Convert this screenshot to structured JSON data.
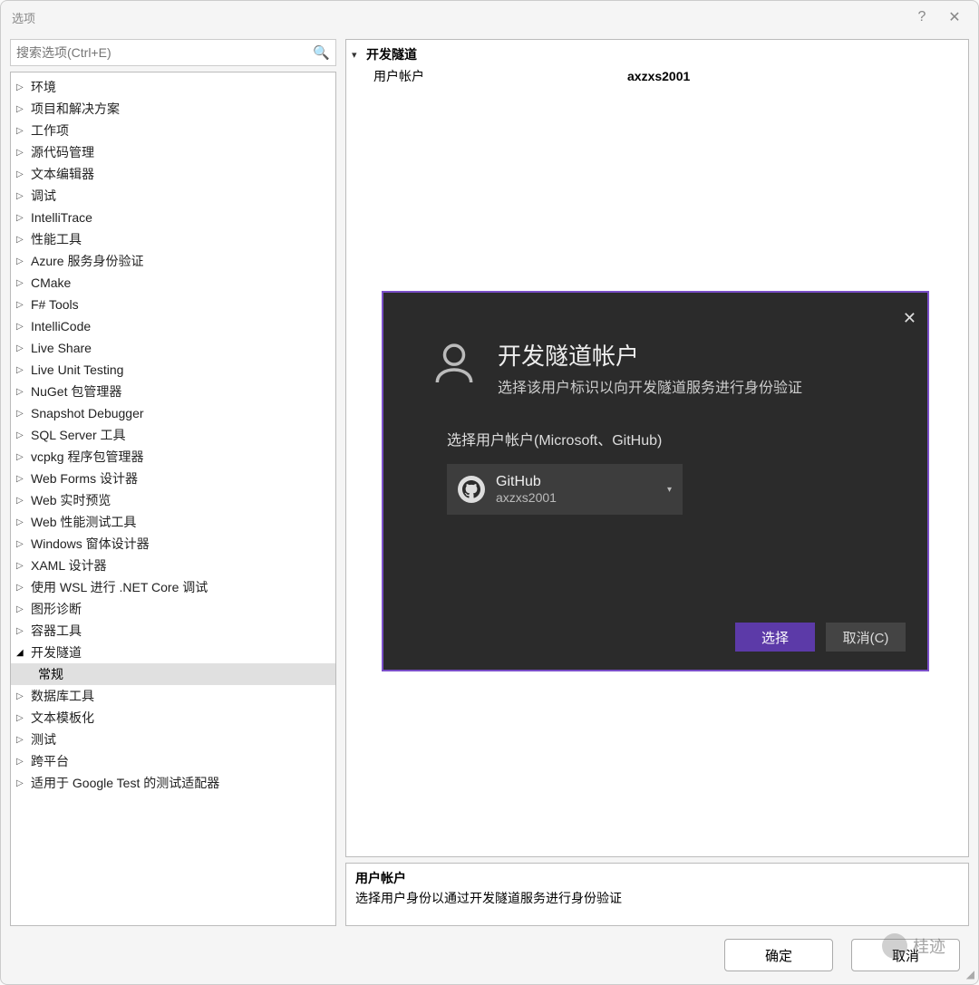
{
  "window": {
    "title": "选项"
  },
  "search": {
    "placeholder": "搜索选项(Ctrl+E)"
  },
  "tree": {
    "items": [
      "环境",
      "项目和解决方案",
      "工作项",
      "源代码管理",
      "文本编辑器",
      "调试",
      "IntelliTrace",
      "性能工具",
      "Azure 服务身份验证",
      "CMake",
      "F# Tools",
      "IntelliCode",
      "Live Share",
      "Live Unit Testing",
      "NuGet 包管理器",
      "Snapshot Debugger",
      "SQL Server 工具",
      "vcpkg 程序包管理器",
      "Web Forms 设计器",
      "Web 实时预览",
      "Web 性能测试工具",
      "Windows 窗体设计器",
      "XAML 设计器",
      "使用 WSL 进行 .NET Core 调试",
      "图形诊断",
      "容器工具"
    ],
    "expanded_item": "开发隧道",
    "expanded_child": "常规",
    "after_items": [
      "数据库工具",
      "文本模板化",
      "测试",
      "跨平台",
      "适用于 Google Test 的测试适配器"
    ]
  },
  "panel": {
    "group_label": "开发隧道",
    "prop_label": "用户帐户",
    "prop_value": "axzxs2001"
  },
  "desc": {
    "title": "用户帐户",
    "text": "选择用户身份以通过开发隧道服务进行身份验证"
  },
  "footer": {
    "ok": "确定",
    "cancel": "取消"
  },
  "modal": {
    "title": "开发隧道帐户",
    "subtitle": "选择该用户标识以向开发隧道服务进行身份验证",
    "prompt": "选择用户帐户(Microsoft、GitHub)",
    "account_provider": "GitHub",
    "account_name": "axzxs2001",
    "select": "选择",
    "cancel": "取消(C)"
  },
  "watermark": "桂迹"
}
